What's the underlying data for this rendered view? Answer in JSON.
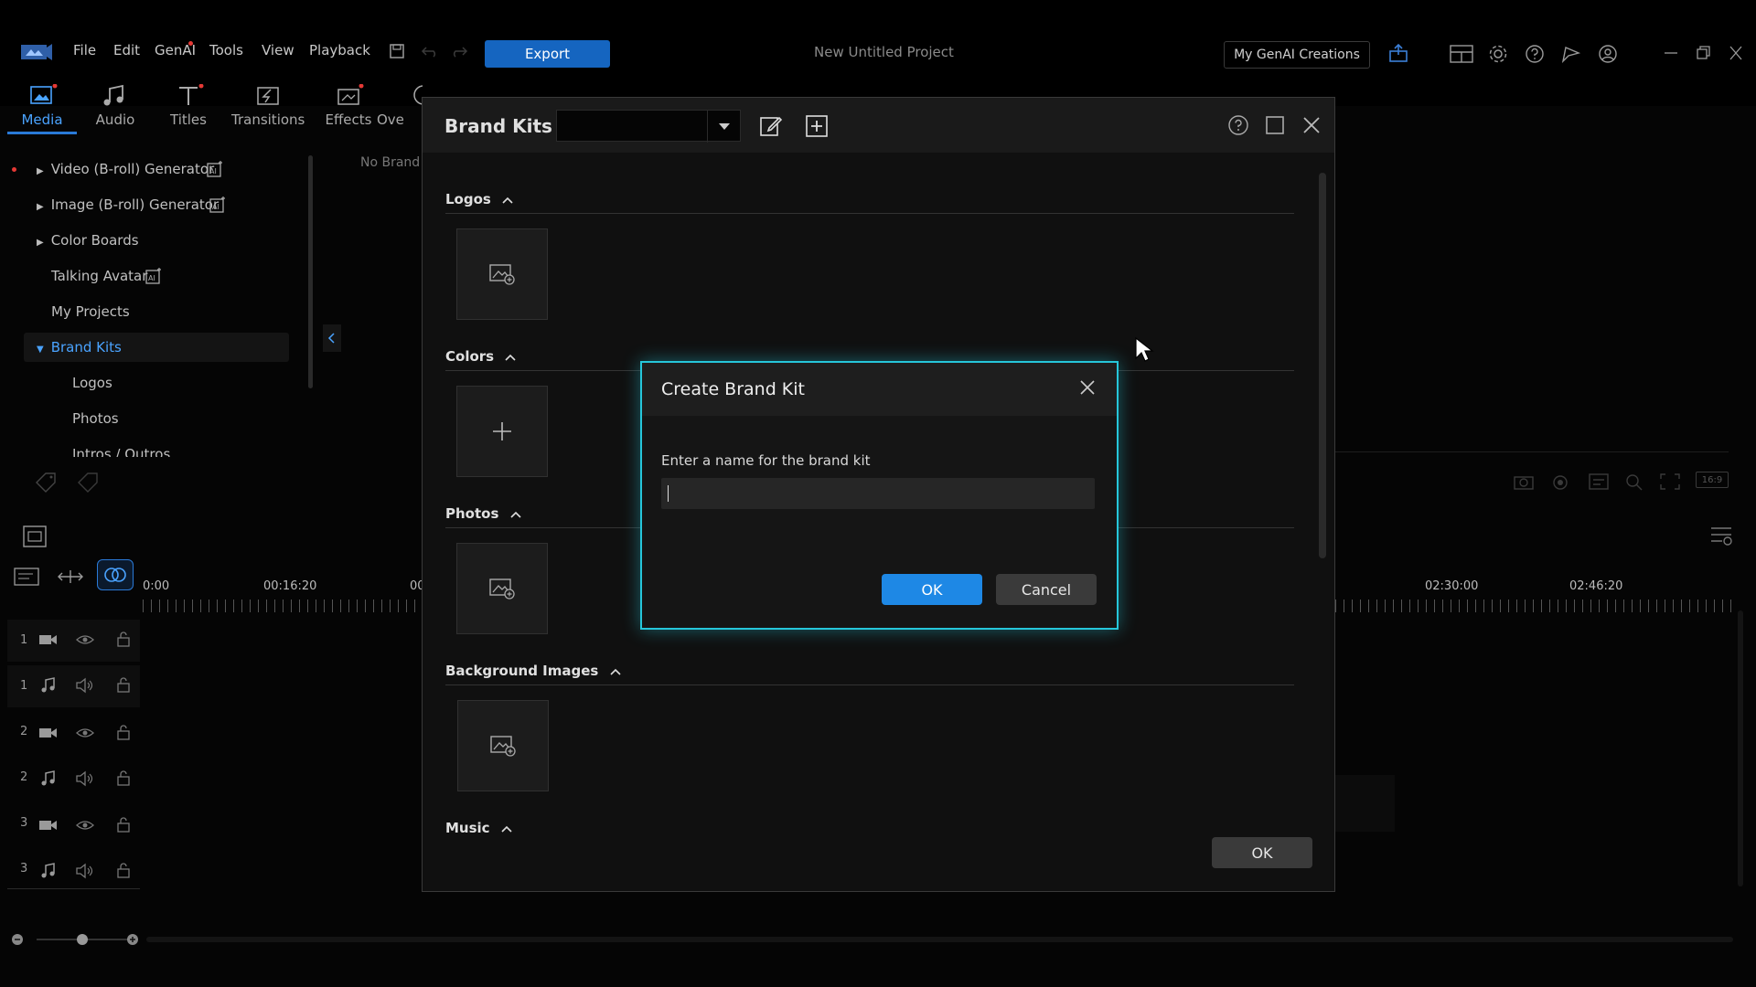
{
  "menu": {
    "file": "File",
    "edit": "Edit",
    "genai": "GenAI",
    "tools": "Tools",
    "view": "View",
    "playback": "Playback",
    "export": "Export",
    "project_title": "New Untitled Project",
    "my_genai": "My GenAI Creations"
  },
  "toolbar": {
    "media": "Media",
    "audio": "Audio",
    "titles": "Titles",
    "transitions": "Transitions",
    "effects": "Effects",
    "overlays_partial": "Ove"
  },
  "tree": {
    "video_broll": "Video (B-roll) Generator",
    "image_broll": "Image (B-roll) Generator",
    "color_boards": "Color Boards",
    "talking_avatar": "Talking Avatar",
    "my_projects": "My Projects",
    "brand_kits": "Brand Kits",
    "logos": "Logos",
    "photos": "Photos",
    "intros_outros": "Intros / Outros",
    "no_brand_partial": "No Brand"
  },
  "timeline": {
    "t0": "0:00",
    "t1": "00:16:20",
    "t2_partial": "00",
    "t3": "02:30:00",
    "t4": "02:46:20",
    "tracks": [
      "1",
      "1",
      "2",
      "2",
      "3",
      "3"
    ],
    "aspect": "16:9"
  },
  "brand_kits": {
    "title": "Brand Kits",
    "dropdown_value": "",
    "sections": {
      "logos": "Logos",
      "colors": "Colors",
      "photos": "Photos",
      "background_images": "Background Images",
      "music": "Music"
    },
    "ok": "OK"
  },
  "create_dialog": {
    "title": "Create Brand Kit",
    "prompt": "Enter a name for the brand kit",
    "input_value": "",
    "ok": "OK",
    "cancel": "Cancel"
  },
  "colors": {
    "accent": "#1e88e5",
    "modal_glow": "#26c6da",
    "notification_dot": "#e53935"
  }
}
